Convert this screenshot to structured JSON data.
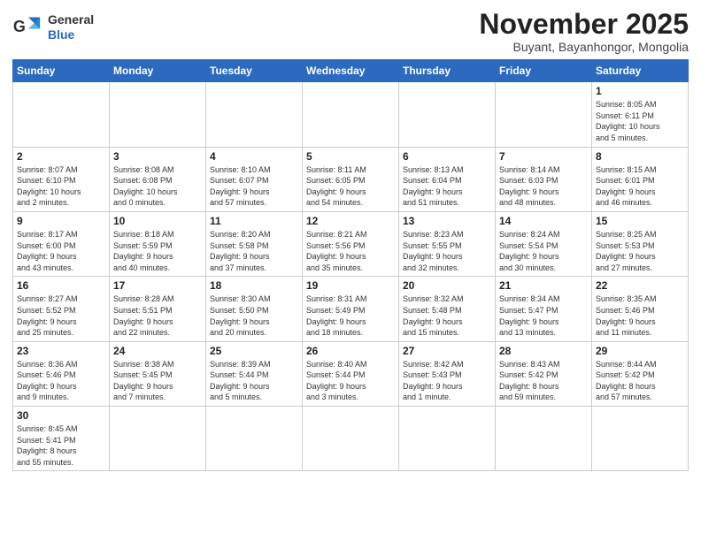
{
  "logo": {
    "line1": "General",
    "line2": "Blue"
  },
  "title": "November 2025",
  "subtitle": "Buyant, Bayanhongor, Mongolia",
  "weekdays": [
    "Sunday",
    "Monday",
    "Tuesday",
    "Wednesday",
    "Thursday",
    "Friday",
    "Saturday"
  ],
  "weeks": [
    [
      {
        "day": "",
        "info": ""
      },
      {
        "day": "",
        "info": ""
      },
      {
        "day": "",
        "info": ""
      },
      {
        "day": "",
        "info": ""
      },
      {
        "day": "",
        "info": ""
      },
      {
        "day": "",
        "info": ""
      },
      {
        "day": "1",
        "info": "Sunrise: 8:05 AM\nSunset: 6:11 PM\nDaylight: 10 hours\nand 5 minutes."
      }
    ],
    [
      {
        "day": "2",
        "info": "Sunrise: 8:07 AM\nSunset: 6:10 PM\nDaylight: 10 hours\nand 2 minutes."
      },
      {
        "day": "3",
        "info": "Sunrise: 8:08 AM\nSunset: 6:08 PM\nDaylight: 10 hours\nand 0 minutes."
      },
      {
        "day": "4",
        "info": "Sunrise: 8:10 AM\nSunset: 6:07 PM\nDaylight: 9 hours\nand 57 minutes."
      },
      {
        "day": "5",
        "info": "Sunrise: 8:11 AM\nSunset: 6:05 PM\nDaylight: 9 hours\nand 54 minutes."
      },
      {
        "day": "6",
        "info": "Sunrise: 8:13 AM\nSunset: 6:04 PM\nDaylight: 9 hours\nand 51 minutes."
      },
      {
        "day": "7",
        "info": "Sunrise: 8:14 AM\nSunset: 6:03 PM\nDaylight: 9 hours\nand 48 minutes."
      },
      {
        "day": "8",
        "info": "Sunrise: 8:15 AM\nSunset: 6:01 PM\nDaylight: 9 hours\nand 46 minutes."
      }
    ],
    [
      {
        "day": "9",
        "info": "Sunrise: 8:17 AM\nSunset: 6:00 PM\nDaylight: 9 hours\nand 43 minutes."
      },
      {
        "day": "10",
        "info": "Sunrise: 8:18 AM\nSunset: 5:59 PM\nDaylight: 9 hours\nand 40 minutes."
      },
      {
        "day": "11",
        "info": "Sunrise: 8:20 AM\nSunset: 5:58 PM\nDaylight: 9 hours\nand 37 minutes."
      },
      {
        "day": "12",
        "info": "Sunrise: 8:21 AM\nSunset: 5:56 PM\nDaylight: 9 hours\nand 35 minutes."
      },
      {
        "day": "13",
        "info": "Sunrise: 8:23 AM\nSunset: 5:55 PM\nDaylight: 9 hours\nand 32 minutes."
      },
      {
        "day": "14",
        "info": "Sunrise: 8:24 AM\nSunset: 5:54 PM\nDaylight: 9 hours\nand 30 minutes."
      },
      {
        "day": "15",
        "info": "Sunrise: 8:25 AM\nSunset: 5:53 PM\nDaylight: 9 hours\nand 27 minutes."
      }
    ],
    [
      {
        "day": "16",
        "info": "Sunrise: 8:27 AM\nSunset: 5:52 PM\nDaylight: 9 hours\nand 25 minutes."
      },
      {
        "day": "17",
        "info": "Sunrise: 8:28 AM\nSunset: 5:51 PM\nDaylight: 9 hours\nand 22 minutes."
      },
      {
        "day": "18",
        "info": "Sunrise: 8:30 AM\nSunset: 5:50 PM\nDaylight: 9 hours\nand 20 minutes."
      },
      {
        "day": "19",
        "info": "Sunrise: 8:31 AM\nSunset: 5:49 PM\nDaylight: 9 hours\nand 18 minutes."
      },
      {
        "day": "20",
        "info": "Sunrise: 8:32 AM\nSunset: 5:48 PM\nDaylight: 9 hours\nand 15 minutes."
      },
      {
        "day": "21",
        "info": "Sunrise: 8:34 AM\nSunset: 5:47 PM\nDaylight: 9 hours\nand 13 minutes."
      },
      {
        "day": "22",
        "info": "Sunrise: 8:35 AM\nSunset: 5:46 PM\nDaylight: 9 hours\nand 11 minutes."
      }
    ],
    [
      {
        "day": "23",
        "info": "Sunrise: 8:36 AM\nSunset: 5:46 PM\nDaylight: 9 hours\nand 9 minutes."
      },
      {
        "day": "24",
        "info": "Sunrise: 8:38 AM\nSunset: 5:45 PM\nDaylight: 9 hours\nand 7 minutes."
      },
      {
        "day": "25",
        "info": "Sunrise: 8:39 AM\nSunset: 5:44 PM\nDaylight: 9 hours\nand 5 minutes."
      },
      {
        "day": "26",
        "info": "Sunrise: 8:40 AM\nSunset: 5:44 PM\nDaylight: 9 hours\nand 3 minutes."
      },
      {
        "day": "27",
        "info": "Sunrise: 8:42 AM\nSunset: 5:43 PM\nDaylight: 9 hours\nand 1 minute."
      },
      {
        "day": "28",
        "info": "Sunrise: 8:43 AM\nSunset: 5:42 PM\nDaylight: 8 hours\nand 59 minutes."
      },
      {
        "day": "29",
        "info": "Sunrise: 8:44 AM\nSunset: 5:42 PM\nDaylight: 8 hours\nand 57 minutes."
      }
    ],
    [
      {
        "day": "30",
        "info": "Sunrise: 8:45 AM\nSunset: 5:41 PM\nDaylight: 8 hours\nand 55 minutes."
      },
      {
        "day": "",
        "info": ""
      },
      {
        "day": "",
        "info": ""
      },
      {
        "day": "",
        "info": ""
      },
      {
        "day": "",
        "info": ""
      },
      {
        "day": "",
        "info": ""
      },
      {
        "day": "",
        "info": ""
      }
    ]
  ]
}
